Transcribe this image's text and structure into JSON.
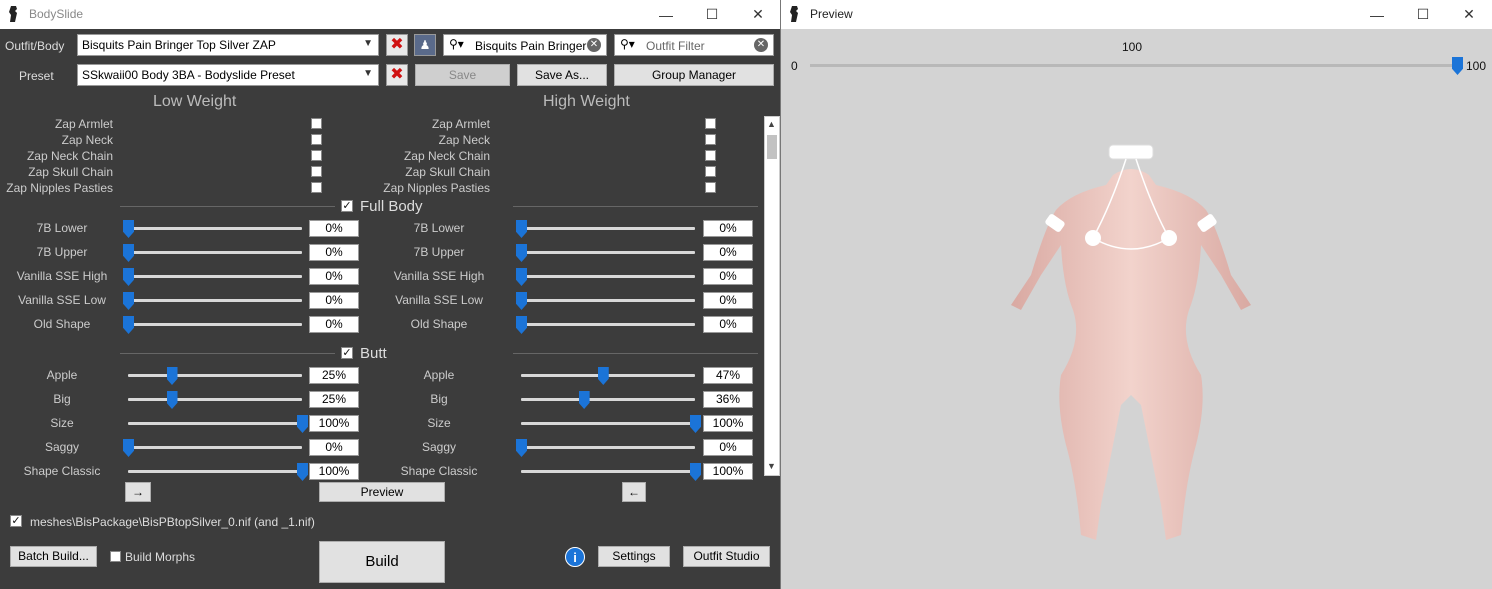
{
  "bodyslide": {
    "title": "BodySlide",
    "outfit_label": "Outfit/Body",
    "outfit_value": "Bisquits Pain Bringer Top Silver ZAP",
    "outfit_search_value": "Bisquits Pain Bringer",
    "outfit_filter_placeholder": "Outfit Filter",
    "preset_label": "Preset",
    "preset_value": "SSkwaii00 Body 3BA - Bodyslide Preset",
    "save_label": "Save",
    "save_as_label": "Save As...",
    "group_manager_label": "Group Manager",
    "low_weight_heading": "Low Weight",
    "high_weight_heading": "High Weight",
    "zaps": [
      "Zap Armlet",
      "Zap Neck",
      "Zap Neck Chain",
      "Zap Skull Chain",
      "Zap Nipples Pasties"
    ],
    "sections": [
      {
        "title": "Full Body",
        "checked": true,
        "sliders": [
          {
            "name": "7B Lower",
            "low": "0%",
            "high": "0%",
            "low_pct": 0,
            "high_pct": 0
          },
          {
            "name": "7B Upper",
            "low": "0%",
            "high": "0%",
            "low_pct": 0,
            "high_pct": 0
          },
          {
            "name": "Vanilla SSE High",
            "low": "0%",
            "high": "0%",
            "low_pct": 0,
            "high_pct": 0
          },
          {
            "name": "Vanilla SSE Low",
            "low": "0%",
            "high": "0%",
            "low_pct": 0,
            "high_pct": 0
          },
          {
            "name": "Old Shape",
            "low": "0%",
            "high": "0%",
            "low_pct": 0,
            "high_pct": 0
          }
        ]
      },
      {
        "title": "Butt",
        "checked": true,
        "sliders": [
          {
            "name": "Apple",
            "low": "25%",
            "high": "47%",
            "low_pct": 25,
            "high_pct": 47
          },
          {
            "name": "Big",
            "low": "25%",
            "high": "36%",
            "low_pct": 25,
            "high_pct": 36
          },
          {
            "name": "Size",
            "low": "100%",
            "high": "100%",
            "low_pct": 100,
            "high_pct": 100
          },
          {
            "name": "Saggy",
            "low": "0%",
            "high": "0%",
            "low_pct": 0,
            "high_pct": 0
          },
          {
            "name": "Shape Classic",
            "low": "100%",
            "high": "100%",
            "low_pct": 100,
            "high_pct": 100
          }
        ]
      }
    ],
    "copy_right_label": "→",
    "copy_left_label": "←",
    "preview_label": "Preview",
    "output_path": "meshes\\BisPackage\\BisPBtopSilver_0.nif (and _1.nif)",
    "batch_build_label": "Batch Build...",
    "build_morphs_label": "Build Morphs",
    "build_label": "Build",
    "settings_label": "Settings",
    "outfit_studio_label": "Outfit Studio",
    "info_icon_text": "i"
  },
  "preview": {
    "title": "Preview",
    "weight_value": "100",
    "weight_min": "0",
    "weight_max": "100",
    "weight_pct": 100
  },
  "colors": {
    "accent": "#1b74d8",
    "panel_bg": "#3c3c3c",
    "preview_bg": "#d3d3d3",
    "close_red": "#d01010"
  }
}
